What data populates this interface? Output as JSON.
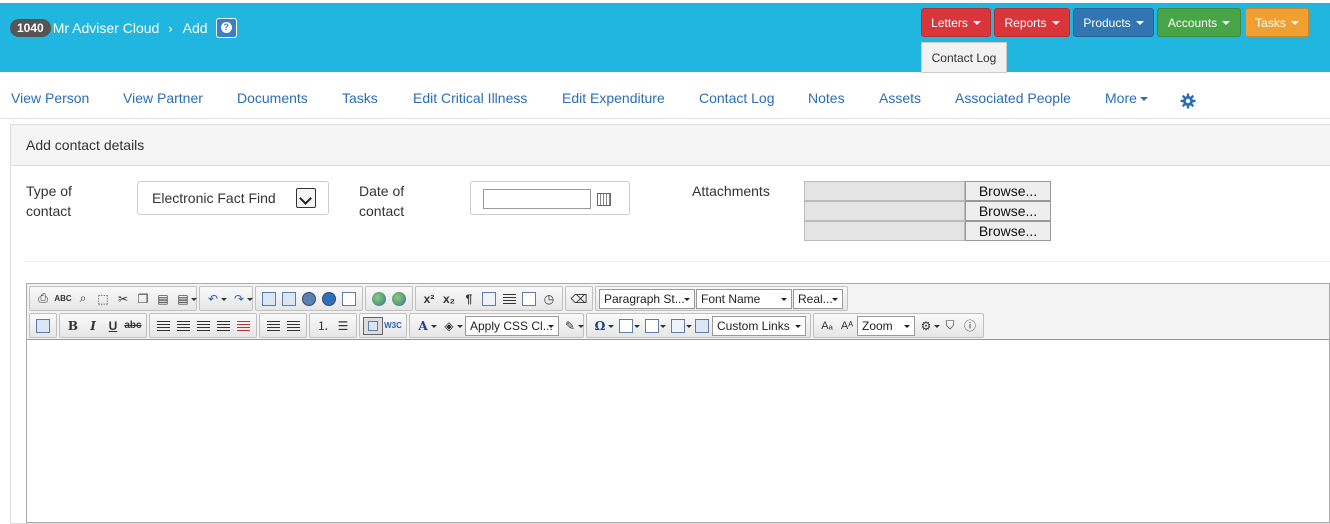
{
  "header": {
    "client_id": "1040",
    "client_name": "Mr Adviser Cloud",
    "breadcrumb_sep": "›",
    "current_page": "Add",
    "help_glyph": "?",
    "bg_color": "#21b6e0"
  },
  "top_buttons": [
    {
      "label": "Letters",
      "color": "#d9363b"
    },
    {
      "label": "Reports",
      "color": "#d9363b"
    },
    {
      "label": "Products",
      "color": "#3276b1"
    },
    {
      "label": "Accounts",
      "color": "#47a447"
    },
    {
      "label": "Tasks",
      "color": "#f0a030"
    }
  ],
  "dropdown_open": {
    "item": "Contact Log"
  },
  "nav": {
    "items": [
      "View Person",
      "View Partner",
      "Documents",
      "Tasks",
      "Edit Critical Illness",
      "Edit Expenditure",
      "Contact Log",
      "Notes",
      "Assets",
      "Associated People"
    ],
    "more": "More",
    "settings_icon": "gear-icon"
  },
  "panel": {
    "title": "Add contact details"
  },
  "form": {
    "type_label_1": "Type of",
    "type_label_2": "contact",
    "type_value": "Electronic Fact Find",
    "date_label_1": "Date of",
    "date_label_2": "contact",
    "date_value": "",
    "attachments_label": "Attachments",
    "browse": [
      "Browse...",
      "Browse...",
      "Browse..."
    ]
  },
  "editor": {
    "paragraph_style": "Paragraph St...",
    "font_name": "Font Name",
    "font_size": "Real...",
    "css_class": "Apply CSS Cl...",
    "custom_links": "Custom Links",
    "zoom": "Zoom"
  }
}
